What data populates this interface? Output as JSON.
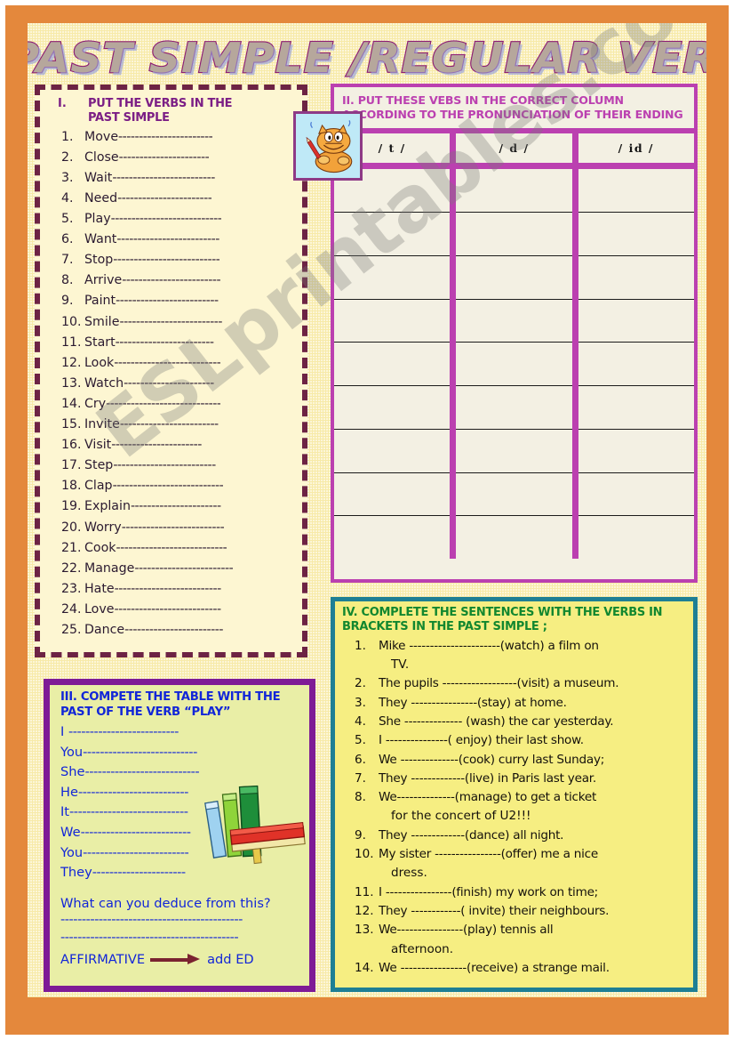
{
  "worksheet": {
    "title": "PAST SIMPLE /REGULAR VERBS",
    "watermark": "ESLprintables.com"
  },
  "colors": {
    "page_border": "#e4883c",
    "paper": "#f7eaa8",
    "title_fill": "#b6a79c",
    "title_stroke": "#8e1f74",
    "sec1_border": "#6d2344",
    "sec1_bg": "#fdf6d2",
    "sec1_heading": "#7b1e85",
    "sec2_border": "#bb40b0",
    "sec2_bg": "#f3f0e3",
    "sec3_border": "#7e1b96",
    "sec3_bg": "#e9eea6",
    "sec3_text": "#1226d8",
    "sec4_border": "#1e7f94",
    "sec4_bg": "#f6ee82",
    "sec4_heading": "#12872f",
    "arrow": "#7a2330"
  },
  "exercise1": {
    "number": "I.",
    "title": "PUT THE VERBS  IN THE PAST SIMPLE",
    "icon": "garfield-cat-writing",
    "verbs": [
      {
        "n": "1.",
        "verb": "Move",
        "dashes": "-----------------------"
      },
      {
        "n": "2.",
        "verb": "Close",
        "dashes": "----------------------"
      },
      {
        "n": "3.",
        "verb": "Wait",
        "dashes": "-------------------------"
      },
      {
        "n": "4.",
        "verb": "Need",
        "dashes": "-----------------------"
      },
      {
        "n": "5.",
        "verb": "Play",
        "dashes": "---------------------------"
      },
      {
        "n": "6.",
        "verb": "Want",
        "dashes": "-------------------------"
      },
      {
        "n": "7.",
        "verb": "Stop",
        "dashes": "--------------------------"
      },
      {
        "n": "8.",
        "verb": "Arrive",
        "dashes": "------------------------"
      },
      {
        "n": "9.",
        "verb": "Paint",
        "dashes": "-------------------------"
      },
      {
        "n": "10.",
        "verb": "Smile",
        "dashes": "-------------------------"
      },
      {
        "n": "11.",
        "verb": "Start",
        "dashes": "------------------------"
      },
      {
        "n": "12.",
        "verb": "Look",
        "dashes": "--------------------------"
      },
      {
        "n": "13.",
        "verb": "Watch ",
        "dashes": "----------------------"
      },
      {
        "n": "14.",
        "verb": "Cry",
        "dashes": "----------------------------"
      },
      {
        "n": "15.",
        "verb": "Invite",
        "dashes": "------------------------"
      },
      {
        "n": "16.",
        "verb": "Visit",
        "dashes": "----------------------"
      },
      {
        "n": "17.",
        "verb": "Step",
        "dashes": "-------------------------"
      },
      {
        "n": "18.",
        "verb": "Clap",
        "dashes": "---------------------------"
      },
      {
        "n": "19.",
        "verb": "Explain",
        "dashes": "----------------------"
      },
      {
        "n": "20.",
        "verb": "Worry",
        "dashes": "-------------------------"
      },
      {
        "n": "21.",
        "verb": "Cook",
        "dashes": "---------------------------"
      },
      {
        "n": "22.",
        "verb": "Manage",
        "dashes": "------------------------"
      },
      {
        "n": "23.",
        "verb": "Hate",
        "dashes": "--------------------------"
      },
      {
        "n": "24.",
        "verb": "Love",
        "dashes": "--------------------------"
      },
      {
        "n": "25.",
        "verb": "Dance",
        "dashes": "------------------------"
      }
    ]
  },
  "exercise2": {
    "title": "II. PUT THESE VEBS IN THE CORRECT COLUMN ACCORDING TO THE PRONUNCIATION OF THEIR ENDING",
    "columns": [
      {
        "header": "/ t /",
        "cells": [
          "",
          "",
          "",
          "",
          "",
          "",
          "",
          "",
          ""
        ]
      },
      {
        "header": "/ d /",
        "cells": [
          "",
          "",
          "",
          "",
          "",
          "",
          "",
          "",
          ""
        ]
      },
      {
        "header": "/ id /",
        "cells": [
          "",
          "",
          "",
          "",
          "",
          "",
          "",
          "",
          ""
        ]
      }
    ]
  },
  "exercise3": {
    "title": "III. COMPETE THE  TABLE WITH THE PAST OF THE VERB “PLAY”",
    "icon": "books-stack",
    "pronouns": [
      {
        "name": "I ",
        "dashes": "--------------------------"
      },
      {
        "name": "You",
        "dashes": "---------------------------"
      },
      {
        "name": "She",
        "dashes": "---------------------------"
      },
      {
        "name": "He",
        "dashes": "--------------------------"
      },
      {
        "name": "It",
        "dashes": "----------------------------"
      },
      {
        "name": "We",
        "dashes": "--------------------------"
      },
      {
        "name": "You",
        "dashes": "-------------------------"
      },
      {
        "name": "They",
        "dashes": "----------------------"
      }
    ],
    "question": "What  can you deduce from this?",
    "answer_lines": [
      "-------------------------------------------",
      "------------------------------------------"
    ],
    "rule_label": "AFFIRMATIVE",
    "rule_result": "add  ED"
  },
  "exercise4": {
    "title": "IV. COMPLETE THE SENTENCES WITH THE  VERBS IN BRACKETS IN THE  PAST SIMPLE ;",
    "sentences": [
      {
        "n": "1.",
        "text": "Mike ----------------------(watch) a film on",
        "cont": "TV."
      },
      {
        "n": "2.",
        "text": "The pupils ------------------(visit) a museum.",
        "cont": ""
      },
      {
        "n": "3.",
        "text": "They ----------------(stay) at home.",
        "cont": ""
      },
      {
        "n": "4.",
        "text": "She -------------- (wash) the car yesterday.",
        "cont": ""
      },
      {
        "n": "5.",
        "text": "I ---------------( enjoy) their last show.",
        "cont": ""
      },
      {
        "n": "6.",
        "text": "We --------------(cook) curry last Sunday;",
        "cont": ""
      },
      {
        "n": "7.",
        "text": "They -------------(live) in Paris  last year.",
        "cont": ""
      },
      {
        "n": "8.",
        "text": "We--------------(manage) to get a ticket",
        "cont": "for the concert of U2!!!"
      },
      {
        "n": "9.",
        "text": "They -------------(dance) all night.",
        "cont": ""
      },
      {
        "n": "10.",
        "text": "My sister ----------------(offer) me a nice",
        "cont": "dress."
      },
      {
        "n": "11.",
        "text": "I ----------------(finish) my work on time;",
        "cont": ""
      },
      {
        "n": "12.",
        "text": "They ------------( invite) their neighbours.",
        "cont": ""
      },
      {
        "n": "13.",
        "text": "We----------------(play) tennis all",
        "cont": "afternoon."
      },
      {
        "n": "14.",
        "text": "We ----------------(receive) a strange mail.",
        "cont": ""
      }
    ]
  }
}
